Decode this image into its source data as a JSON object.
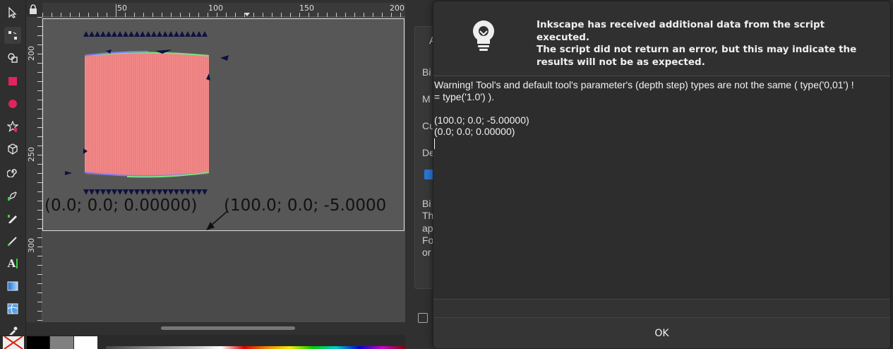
{
  "toolbox": {
    "tools": [
      {
        "name": "selector-tool",
        "icon": "arrow-cursor-icon"
      },
      {
        "name": "node-tool",
        "icon": "node-edit-icon"
      },
      {
        "name": "shape-builder-tool",
        "icon": "shape-builder-icon"
      },
      {
        "name": "rectangle-tool",
        "icon": "rectangle-icon"
      },
      {
        "name": "ellipse-tool",
        "icon": "circle-icon"
      },
      {
        "name": "star-tool",
        "icon": "star-icon"
      },
      {
        "name": "3dbox-tool",
        "icon": "cube-icon"
      },
      {
        "name": "spiral-tool",
        "icon": "spiral-icon"
      },
      {
        "name": "pen-tool",
        "icon": "pen-icon"
      },
      {
        "name": "pencil-tool",
        "icon": "pencil-icon"
      },
      {
        "name": "calligraphy-tool",
        "icon": "calligraphy-icon"
      },
      {
        "name": "text-tool",
        "icon": "text-icon"
      },
      {
        "name": "gradient-tool",
        "icon": "gradient-icon"
      },
      {
        "name": "mesh-tool",
        "icon": "mesh-icon"
      },
      {
        "name": "dropper-tool",
        "icon": "dropper-icon"
      }
    ],
    "text_tool_glyph": "A"
  },
  "ruler": {
    "top_labels": [
      "50",
      "100",
      "150",
      "200"
    ],
    "left_labels": [
      "200",
      "250",
      "300"
    ]
  },
  "canvas": {
    "label_left": "(0.0; 0.0; 0.00000)",
    "label_right": "(100.0; 0.0; -5.0000",
    "shape_fill": "#f48a8a",
    "path_color": "#0d1240",
    "edge_green": "#7fe07f",
    "edge_blue": "#7e7ef0"
  },
  "palette": {
    "swatches": [
      "#000000",
      "#808080",
      "#ffffff"
    ]
  },
  "background_panel": {
    "labels": [
      "A",
      "Bi",
      "M",
      "Cu",
      "De",
      "Bi",
      "Th",
      "ap",
      "Fo",
      "or"
    ]
  },
  "dialog": {
    "icon": "lightbulb-icon",
    "message": "Inkscape has received additional data from the script executed.\nThe script did not return an error, but this may indicate the\nresults will not be as expected.",
    "output_text": "Warning! Tool's and default tool's parameter's (depth step) types are not the same ( type('0,01') !\n= type('1.0') ).\n\n(100.0; 0.0; -5.00000)\n(0.0; 0.0; 0.00000)",
    "ok_label": "OK"
  }
}
